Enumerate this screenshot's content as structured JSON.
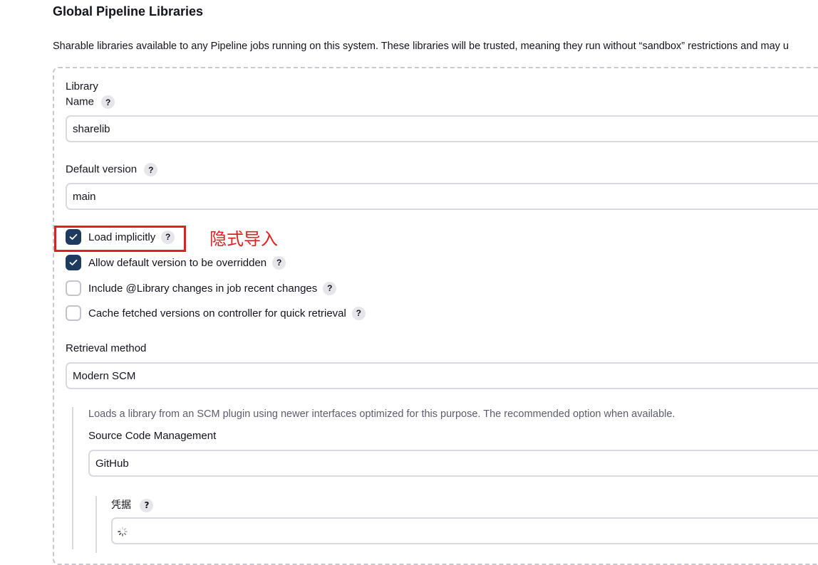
{
  "section": {
    "title": "Global Pipeline Libraries",
    "description": "Sharable libraries available to any Pipeline jobs running on this system. These libraries will be trusted, meaning they run without “sandbox” restrictions and may u"
  },
  "library": {
    "name_label_line1": "Library",
    "name_label_line2": "Name",
    "name_value": "sharelib",
    "default_version_label": "Default version",
    "default_version_value": "main",
    "checkboxes": [
      {
        "label": "Load implicitly",
        "checked": true
      },
      {
        "label": "Allow default version to be overridden",
        "checked": true
      },
      {
        "label": "Include @Library changes in job recent changes",
        "checked": false
      },
      {
        "label": "Cache fetched versions on controller for quick retrieval",
        "checked": false
      }
    ],
    "retrieval_label": "Retrieval method",
    "retrieval_value": "Modern SCM",
    "retrieval_description": "Loads a library from an SCM plugin using newer interfaces optimized for this purpose. The recommended option when available.",
    "scm_label": "Source Code Management",
    "scm_value": "GitHub",
    "credentials_label": "凭据"
  },
  "annotation": {
    "text": "隐式导入",
    "color": "#e02020"
  },
  "help_glyph": "?",
  "colors": {
    "checkbox_checked": "#1e3a5f",
    "border": "#d9d9e0"
  }
}
